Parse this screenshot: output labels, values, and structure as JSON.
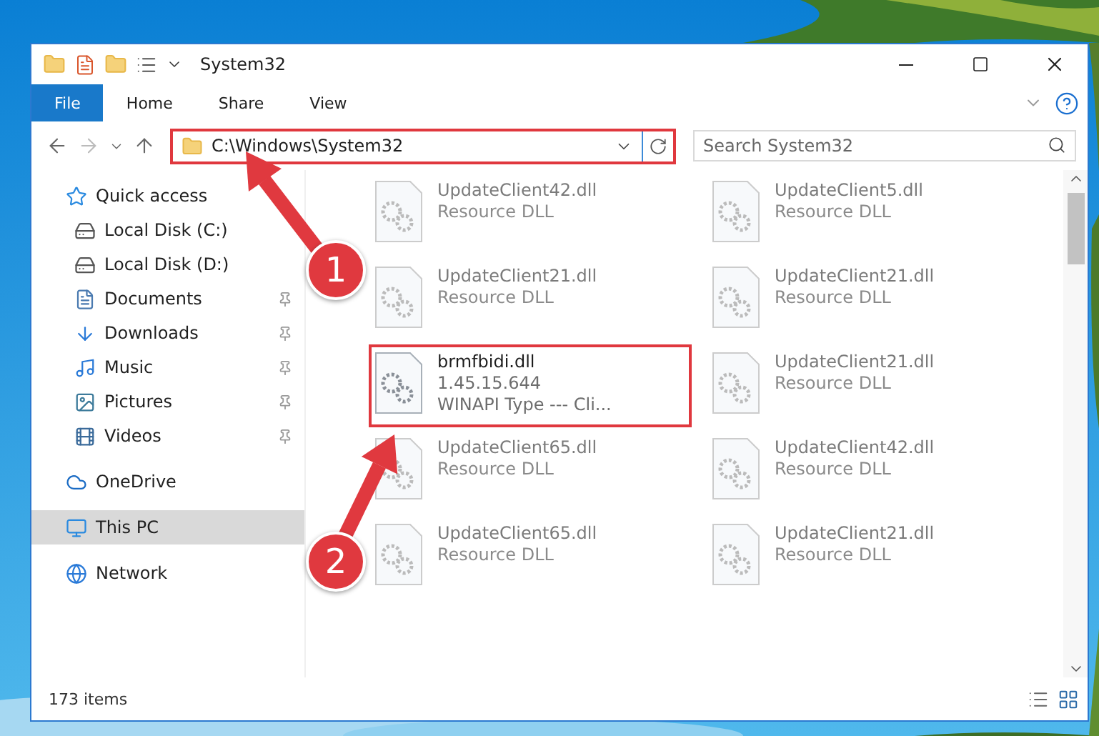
{
  "window": {
    "title": "System32"
  },
  "ribbon_tabs": [
    {
      "label": "File",
      "kind": "file",
      "selected": false
    },
    {
      "label": "Home",
      "kind": "tab",
      "selected": false
    },
    {
      "label": "Share",
      "kind": "tab",
      "selected": false
    },
    {
      "label": "View",
      "kind": "tab",
      "selected": false
    }
  ],
  "address_bar": {
    "path": "C:\\Windows\\System32",
    "highlighted": true
  },
  "search": {
    "placeholder": "Search System32"
  },
  "sidebar": {
    "items": [
      {
        "label": "Quick access",
        "kind": "group",
        "pinned": false,
        "selected": false
      },
      {
        "label": "Local Disk (C:)",
        "kind": "item",
        "pinned": false,
        "selected": false
      },
      {
        "label": "Local Disk (D:)",
        "kind": "item",
        "pinned": false,
        "selected": false
      },
      {
        "label": "Documents",
        "kind": "item",
        "pinned": true,
        "selected": false
      },
      {
        "label": "Downloads",
        "kind": "item",
        "pinned": true,
        "selected": false
      },
      {
        "label": "Music",
        "kind": "item",
        "pinned": true,
        "selected": false
      },
      {
        "label": "Pictures",
        "kind": "item",
        "pinned": true,
        "selected": false
      },
      {
        "label": "Videos",
        "kind": "item",
        "pinned": true,
        "selected": false
      },
      {
        "label": "OneDrive",
        "kind": "group",
        "pinned": false,
        "selected": false
      },
      {
        "label": "This PC",
        "kind": "group",
        "pinned": false,
        "selected": true
      },
      {
        "label": "Network",
        "kind": "group",
        "pinned": false,
        "selected": false
      }
    ]
  },
  "files": [
    {
      "name": "UpdateClient42.dll",
      "lines": [
        "Resource DLL"
      ],
      "dimmed": true,
      "highlighted": false
    },
    {
      "name": "UpdateClient5.dll",
      "lines": [
        "Resource DLL"
      ],
      "dimmed": true,
      "highlighted": false
    },
    {
      "name": "UpdateClient21.dll",
      "lines": [
        "Resource DLL"
      ],
      "dimmed": true,
      "highlighted": false
    },
    {
      "name": "UpdateClient21.dll",
      "lines": [
        "Resource DLL"
      ],
      "dimmed": true,
      "highlighted": false
    },
    {
      "name": "brmfbidi.dll",
      "lines": [
        "1.45.15.644",
        "WINAPI Type --- Cli..."
      ],
      "dimmed": false,
      "highlighted": true
    },
    {
      "name": "UpdateClient21.dll",
      "lines": [
        "Resource DLL"
      ],
      "dimmed": true,
      "highlighted": false
    },
    {
      "name": "UpdateClient65.dll",
      "lines": [
        "Resource DLL"
      ],
      "dimmed": true,
      "highlighted": false
    },
    {
      "name": "UpdateClient42.dll",
      "lines": [
        "Resource DLL"
      ],
      "dimmed": true,
      "highlighted": false
    },
    {
      "name": "UpdateClient65.dll",
      "lines": [
        "Resource DLL"
      ],
      "dimmed": true,
      "highlighted": false
    },
    {
      "name": "UpdateClient21.dll",
      "lines": [
        "Resource DLL"
      ],
      "dimmed": true,
      "highlighted": false
    }
  ],
  "status_bar": {
    "count": "173 items"
  },
  "annotations": [
    {
      "label": "1"
    },
    {
      "label": "2"
    }
  ]
}
